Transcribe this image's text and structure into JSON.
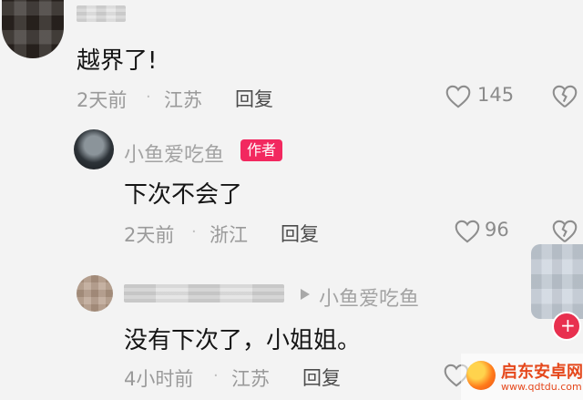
{
  "comment1": {
    "text": "越界了!",
    "time": "2天前",
    "location": "江苏",
    "reply_label": "回复",
    "like_count": "145"
  },
  "reply1": {
    "username": "小鱼爱吃鱼",
    "author_tag": "作者",
    "text": "下次不会了",
    "time": "2天前",
    "location": "浙江",
    "reply_label": "回复",
    "like_count": "96"
  },
  "reply2": {
    "reply_to": "小鱼爱吃鱼",
    "text": "没有下次了，小姐姐。",
    "time": "4小时前",
    "location": "江苏",
    "reply_label": "回复"
  },
  "meta_separator": "·",
  "watermark": {
    "line1": "启东安卓网",
    "line2": "www.qdtdu.com"
  },
  "colors": {
    "background": "#f3f3f3",
    "author_tag_bg": "#f2285f",
    "follow_badge": "#e8304f"
  }
}
